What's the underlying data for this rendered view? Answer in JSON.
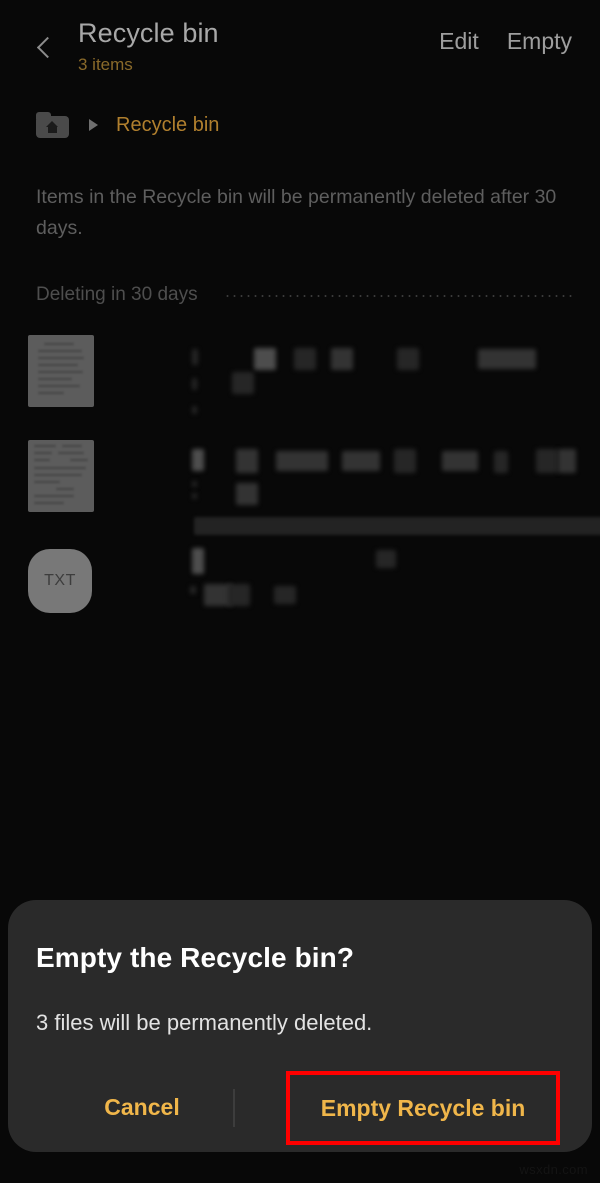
{
  "appbar": {
    "back_icon": "chevron-left-icon",
    "title": "Recycle bin",
    "subtitle": "3 items",
    "actions": [
      {
        "label": "Edit",
        "name": "edit-button"
      },
      {
        "label": "Empty",
        "name": "empty-button"
      }
    ]
  },
  "breadcrumb": {
    "home_icon": "home-folder-icon",
    "separator_icon": "triangle-right-icon",
    "current": "Recycle bin"
  },
  "notice": "Items in the Recycle bin will be permanently deleted after 30 days.",
  "section": {
    "title": "Deleting in 30 days"
  },
  "files": [
    {
      "thumb_type": "document",
      "name_redacted": true
    },
    {
      "thumb_type": "document",
      "name_redacted": true
    },
    {
      "thumb_type": "txt",
      "badge_label": "TXT",
      "name_redacted": true
    }
  ],
  "dialog": {
    "title": "Empty the Recycle bin?",
    "body": "3 files will be permanently deleted.",
    "cancel_label": "Cancel",
    "confirm_label": "Empty Recycle bin"
  },
  "highlight": {
    "color": "#ff0000",
    "target": "confirm-button"
  },
  "colors": {
    "screen_background": "#080808",
    "dialog_background": "#2a2a2a",
    "accent_amber": "#f0b64a",
    "breadcrumb_amber": "#b07f2e",
    "subtitle_amber": "#8a6a2a",
    "primary_text": "#ffffff",
    "muted_text": "#5e5e5e"
  },
  "watermark": "wsxdn.com"
}
